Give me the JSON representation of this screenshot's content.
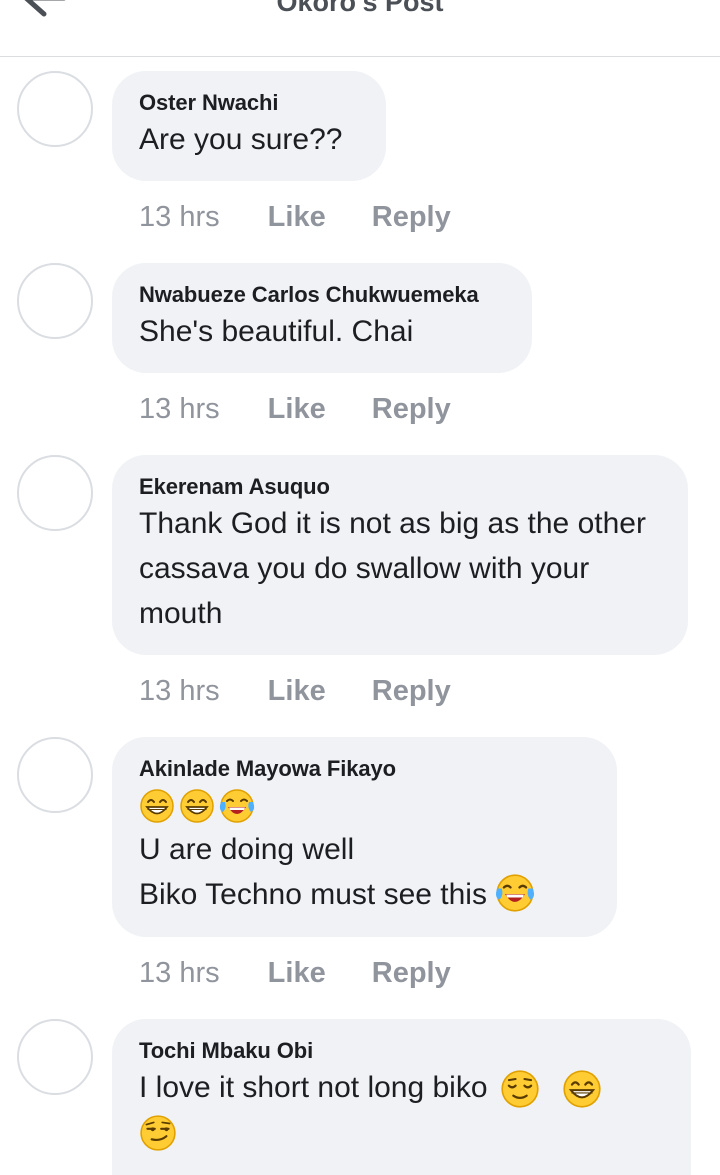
{
  "header": {
    "title": "Okoro's Post",
    "back_icon": "arrow-left-icon"
  },
  "comments": [
    {
      "author": "Oster Nwachi",
      "text": "Are you sure??",
      "time": "13 hrs",
      "like_label": "Like",
      "reply_label": "Reply"
    },
    {
      "author": "Nwabueze Carlos Chukwuemeka",
      "text": "She's beautiful. Chai",
      "time": "13 hrs",
      "like_label": "Like",
      "reply_label": "Reply"
    },
    {
      "author": "Ekerenam Asuquo",
      "text": "Thank God it is not as big as the other cassava you do swallow with your mouth",
      "time": "13 hrs",
      "like_label": "Like",
      "reply_label": "Reply"
    },
    {
      "author": "Akinlade Mayowa Fikayo",
      "emojis": [
        "grinning-face-emoji",
        "grinning-face-emoji",
        "tears-of-joy-emoji"
      ],
      "text_line1": "U are doing well",
      "text_line2": "Biko Techno must see this",
      "text_line2_emoji": "tears-of-joy-emoji",
      "time": "13 hrs",
      "like_label": "Like",
      "reply_label": "Reply"
    },
    {
      "author": "Tochi Mbaku Obi",
      "text": "I love it short not long biko",
      "text_emojis": [
        "relieved-face-emoji",
        "grinning-face-emoji"
      ],
      "trailing_emoji": "smirking-face-emoji"
    }
  ]
}
